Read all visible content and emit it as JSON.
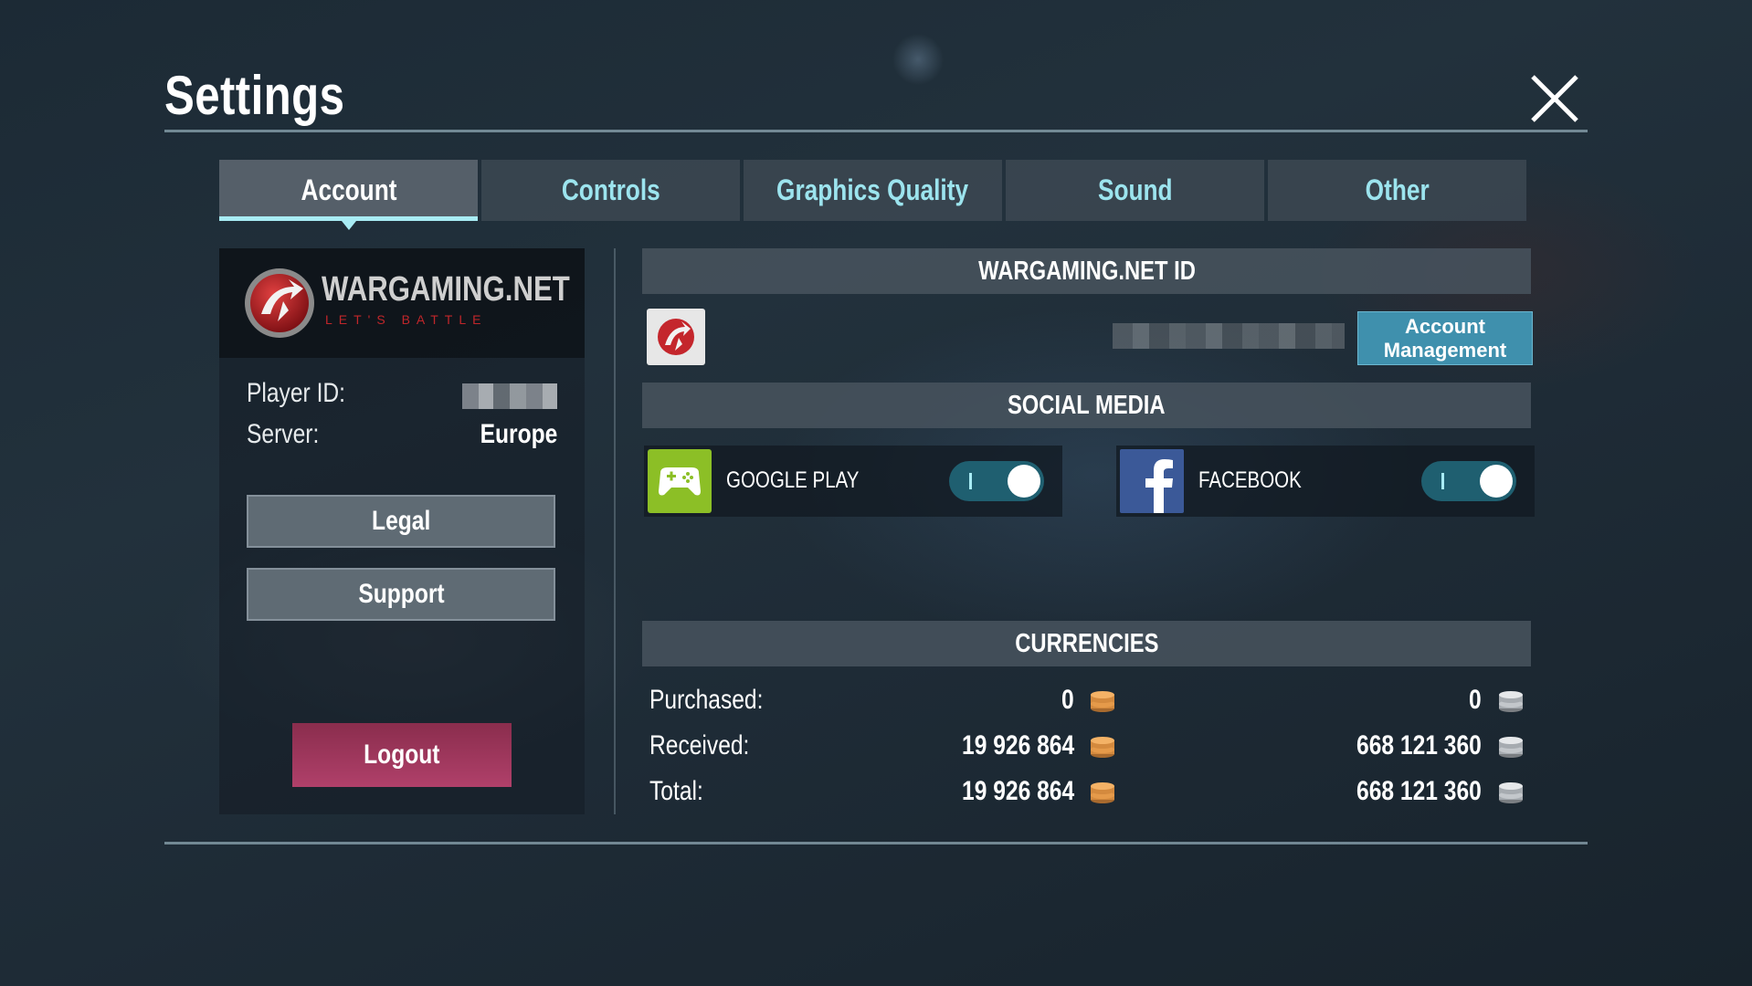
{
  "header": {
    "title": "Settings"
  },
  "tabs": [
    {
      "label": "Account",
      "active": true
    },
    {
      "label": "Controls",
      "active": false
    },
    {
      "label": "Graphics Quality",
      "active": false
    },
    {
      "label": "Sound",
      "active": false
    },
    {
      "label": "Other",
      "active": false
    }
  ],
  "left_panel": {
    "brand": {
      "name": "WARGAMING.NET",
      "tagline": "LET'S BATTLE"
    },
    "player_id_label": "Player ID:",
    "server_label": "Server:",
    "server_value": "Europe",
    "legal_label": "Legal",
    "support_label": "Support",
    "logout_label": "Logout"
  },
  "account": {
    "header": "WARGAMING.NET ID",
    "management_line1": "Account",
    "management_line2": "Management"
  },
  "social": {
    "header": "SOCIAL MEDIA",
    "items": [
      {
        "label": "GOOGLE PLAY",
        "enabled": true,
        "icon": "gamepad-icon"
      },
      {
        "label": "FACEBOOK",
        "enabled": true,
        "icon": "facebook-icon"
      }
    ]
  },
  "currencies": {
    "header": "CURRENCIES",
    "rows": [
      {
        "label": "Purchased:",
        "gold": "0",
        "silver": "0"
      },
      {
        "label": "Received:",
        "gold": "19 926 864",
        "silver": "668 121 360"
      },
      {
        "label": "Total:",
        "gold": "19 926 864",
        "silver": "668 121 360"
      }
    ]
  },
  "colors": {
    "accent": "#a8ecf4",
    "tab_text": "#9ce4ee",
    "account_button": "#3f90ad",
    "logout": "#b0406a",
    "toggle_on": "#1f5f70"
  }
}
